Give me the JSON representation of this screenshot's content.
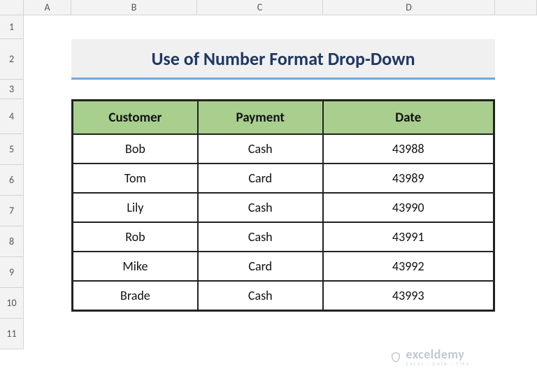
{
  "columns": {
    "A": "A",
    "B": "B",
    "C": "C",
    "D": "D",
    "E": ""
  },
  "rows": {
    "r1": "1",
    "r2": "2",
    "r3": "3",
    "r4": "4",
    "r5": "5",
    "r6": "6",
    "r7": "7",
    "r8": "8",
    "r9": "9",
    "r10": "10",
    "r11": "11"
  },
  "title": "Use of Number Format Drop-Down",
  "headers": {
    "customer": "Customer",
    "payment": "Payment",
    "date": "Date"
  },
  "data": [
    {
      "customer": "Bob",
      "payment": "Cash",
      "date": "43988"
    },
    {
      "customer": "Tom",
      "payment": "Card",
      "date": "43989"
    },
    {
      "customer": "Lily",
      "payment": "Cash",
      "date": "43990"
    },
    {
      "customer": "Rob",
      "payment": "Cash",
      "date": "43991"
    },
    {
      "customer": "Mike",
      "payment": "Card",
      "date": "43992"
    },
    {
      "customer": "Brade",
      "payment": "Cash",
      "date": "43993"
    }
  ],
  "watermark": {
    "brand": "exceldemy",
    "sub": "EXCEL · DATA · TIPS"
  },
  "chart_data": {
    "type": "table",
    "title": "Use of Number Format Drop-Down",
    "columns": [
      "Customer",
      "Payment",
      "Date"
    ],
    "rows": [
      [
        "Bob",
        "Cash",
        43988
      ],
      [
        "Tom",
        "Card",
        43989
      ],
      [
        "Lily",
        "Cash",
        43990
      ],
      [
        "Rob",
        "Cash",
        43991
      ],
      [
        "Mike",
        "Card",
        43992
      ],
      [
        "Brade",
        "Cash",
        43993
      ]
    ]
  }
}
